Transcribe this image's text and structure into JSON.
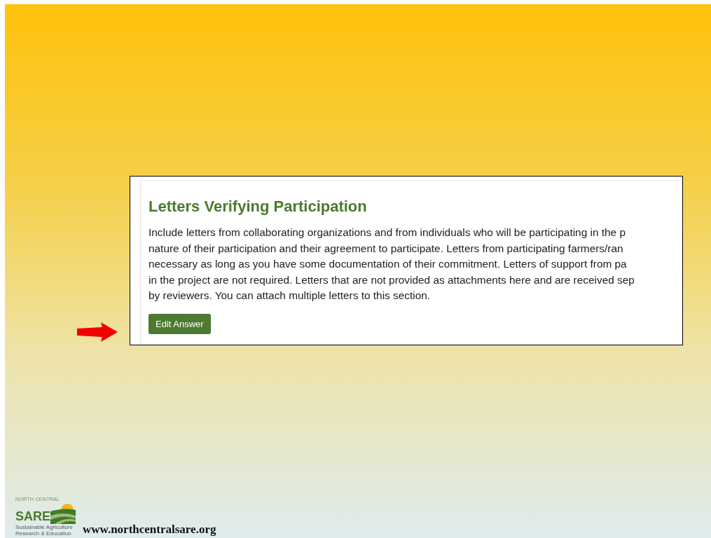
{
  "card": {
    "title": "Letters Verifying Participation",
    "lines": [
      "Include letters from collaborating organizations and from individuals who will be participating in the p",
      "nature of their participation and their agreement to participate. Letters from participating farmers/ran",
      "necessary as long as you have some documentation of their commitment. Letters of support from pa",
      "in the project are not required. Letters that are not provided as attachments here and are received sep",
      "by reviewers. You can attach multiple letters to this section."
    ],
    "button": "Edit Answer"
  },
  "footer": {
    "logo": {
      "top_text": "NORTH CENTRAL",
      "name": "SARE",
      "tagline": [
        "Sustainable Agriculture",
        "Research & Education"
      ]
    },
    "url": "www.northcentralsare.org"
  }
}
